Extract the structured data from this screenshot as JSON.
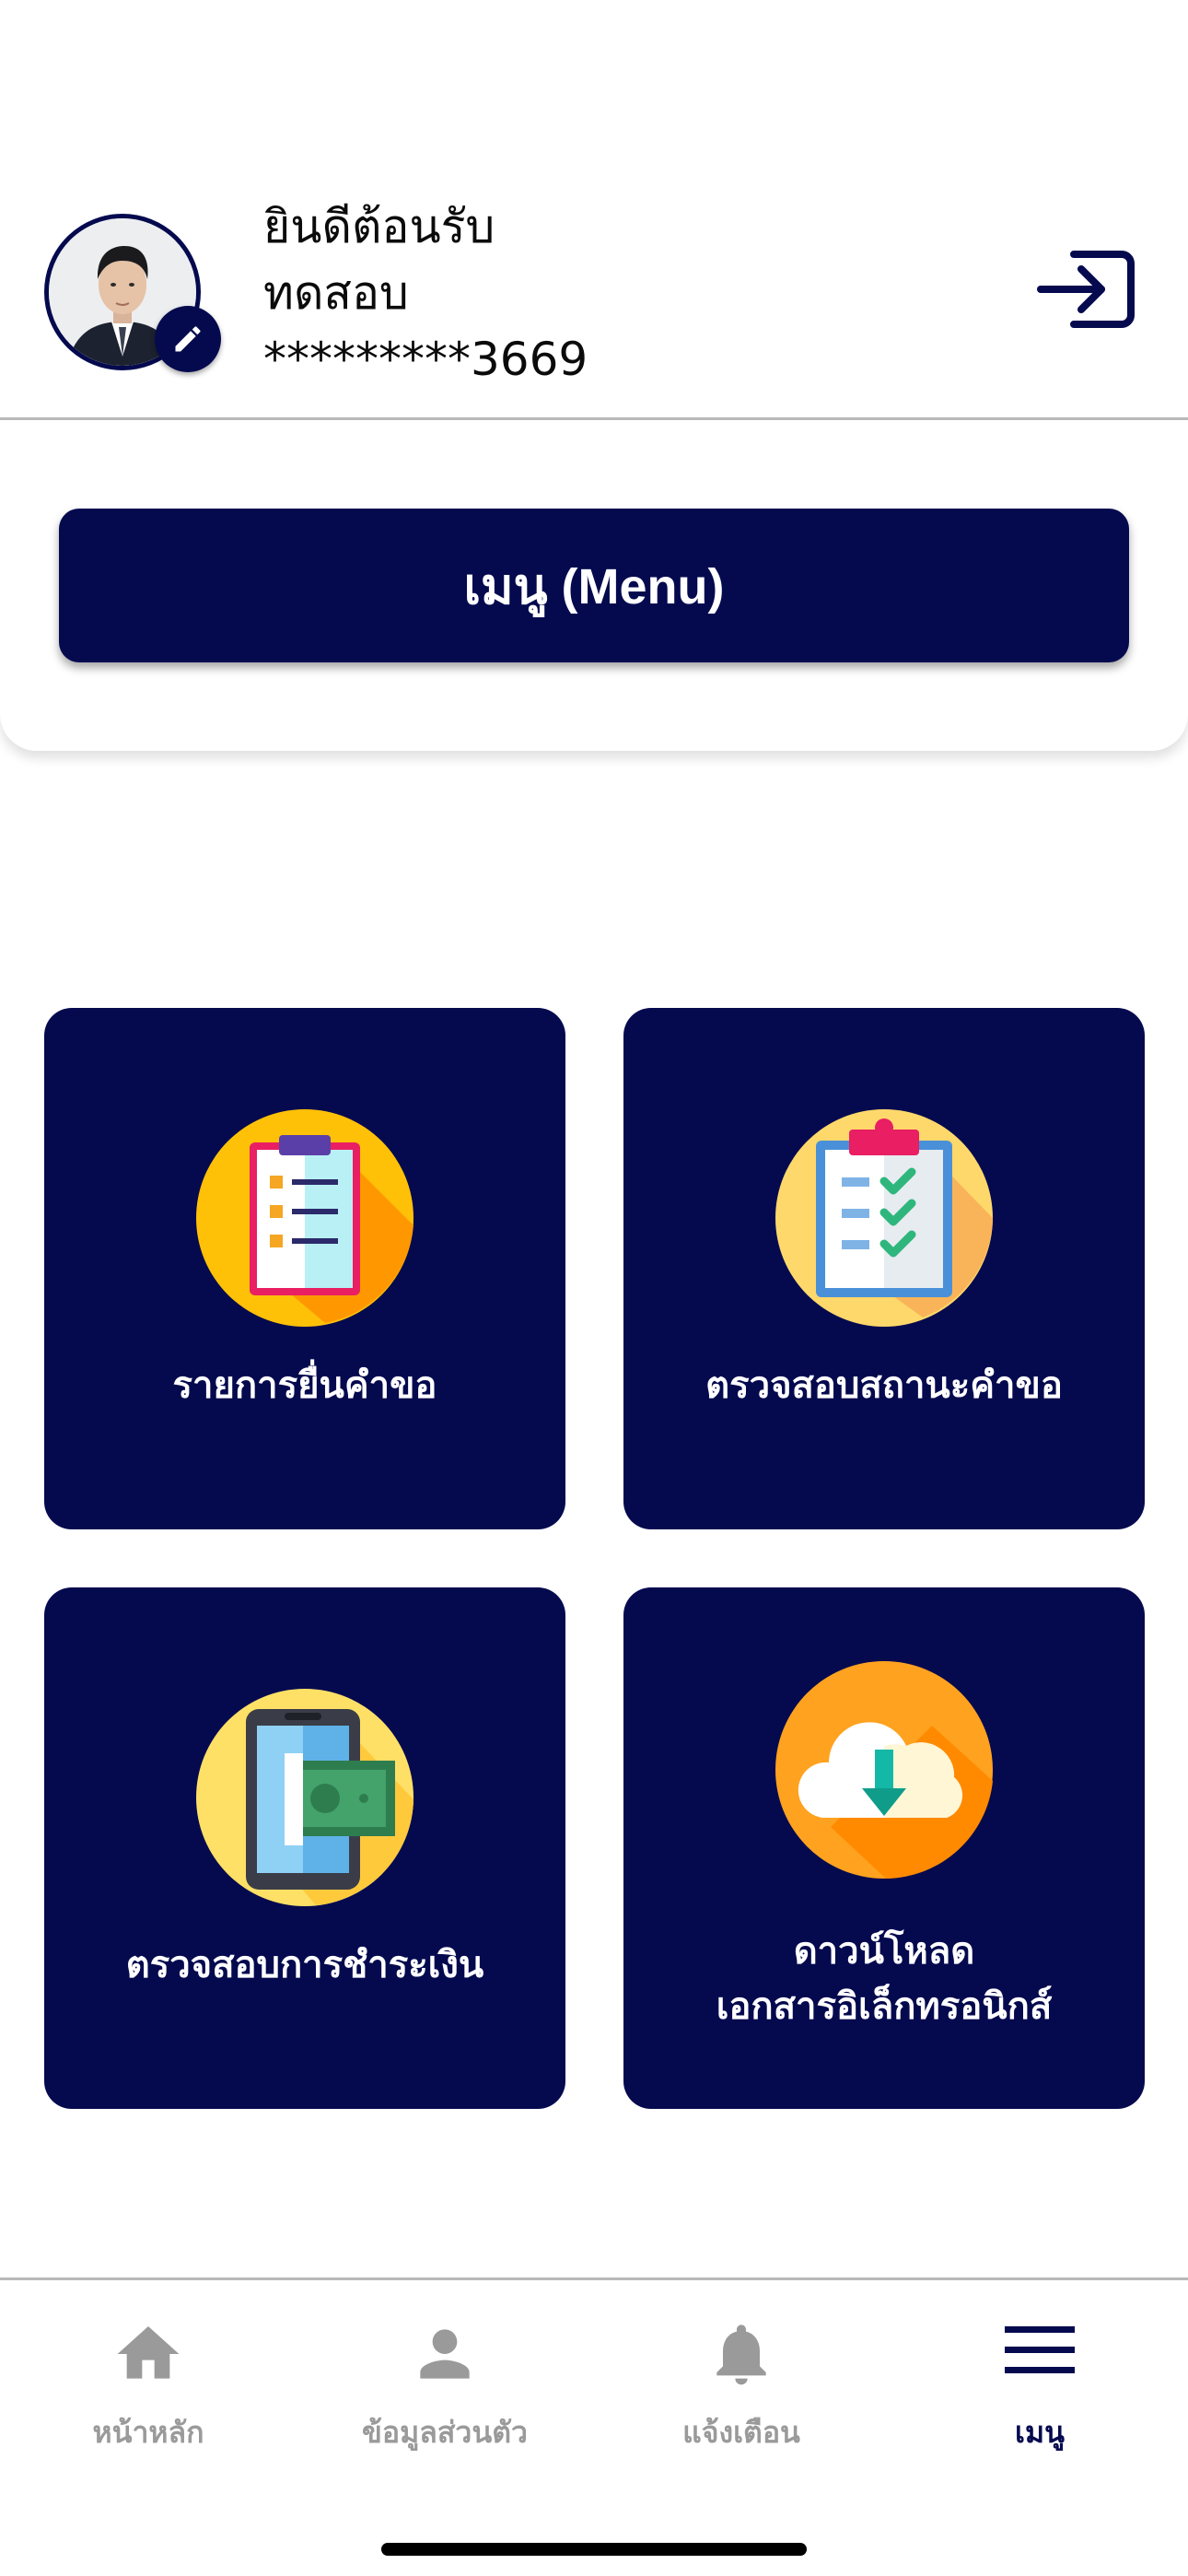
{
  "header": {
    "welcome_line": "ยินดีต้อนรับ",
    "user_name": "ทดสอบ",
    "masked_id": "*********3669",
    "avatar_icon": "profile-photo",
    "edit_icon": "pencil-icon",
    "logout_icon": "logout-icon"
  },
  "menu": {
    "title_button": "เมนู (Menu)"
  },
  "tiles": [
    {
      "label": "รายการยื่นคำขอ",
      "icon": "clipboard-list-icon"
    },
    {
      "label": "ตรวจสอบสถานะคำขอ",
      "icon": "clipboard-check-icon"
    },
    {
      "label": "ตรวจสอบการชำระเงิน",
      "icon": "mobile-payment-icon"
    },
    {
      "label_line1": "ดาวน์โหลด",
      "label_line2": "เอกสารอิเล็กทรอนิกส์",
      "icon": "cloud-download-icon"
    }
  ],
  "bottom_nav": [
    {
      "label": "หน้าหลัก",
      "icon": "home-icon",
      "active": false
    },
    {
      "label": "ข้อมูลส่วนตัว",
      "icon": "person-icon",
      "active": false
    },
    {
      "label": "แจ้งเตือน",
      "icon": "bell-icon",
      "active": false
    },
    {
      "label": "เมนู",
      "icon": "hamburger-menu-icon",
      "active": true
    }
  ],
  "colors": {
    "primary": "#050a4f",
    "inactive_nav": "#9a9a9a",
    "divider": "#b9b9b9",
    "background": "#ffffff"
  }
}
